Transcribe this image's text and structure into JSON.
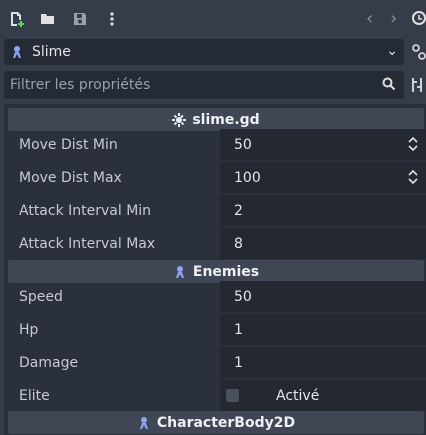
{
  "toolbar": {
    "icons": [
      "new-resource-icon",
      "open-folder-icon",
      "save-icon",
      "more-vertical-icon",
      "history-back-icon",
      "history-forward-icon"
    ]
  },
  "node": {
    "name": "Slime",
    "icon": "character-body-icon"
  },
  "filter": {
    "placeholder": "Filtrer les propriétés"
  },
  "sections": {
    "script": "slime.gd",
    "enemies": "Enemies",
    "body": "CharacterBody2D"
  },
  "properties": [
    {
      "label": "Move Dist Min",
      "value": "50"
    },
    {
      "label": "Move Dist Max",
      "value": "100"
    },
    {
      "label": "Attack Interval Min",
      "value": "2"
    },
    {
      "label": "Attack Interval Max",
      "value": "8"
    },
    {
      "label": "Speed",
      "value": "50"
    },
    {
      "label": "Hp",
      "value": "1"
    },
    {
      "label": "Damage",
      "value": "1"
    },
    {
      "label": "Elite",
      "value": "Activé",
      "checked": false
    }
  ],
  "colors": {
    "accent": "#8da5f3",
    "panel": "#2b313c",
    "section": "#404754"
  }
}
